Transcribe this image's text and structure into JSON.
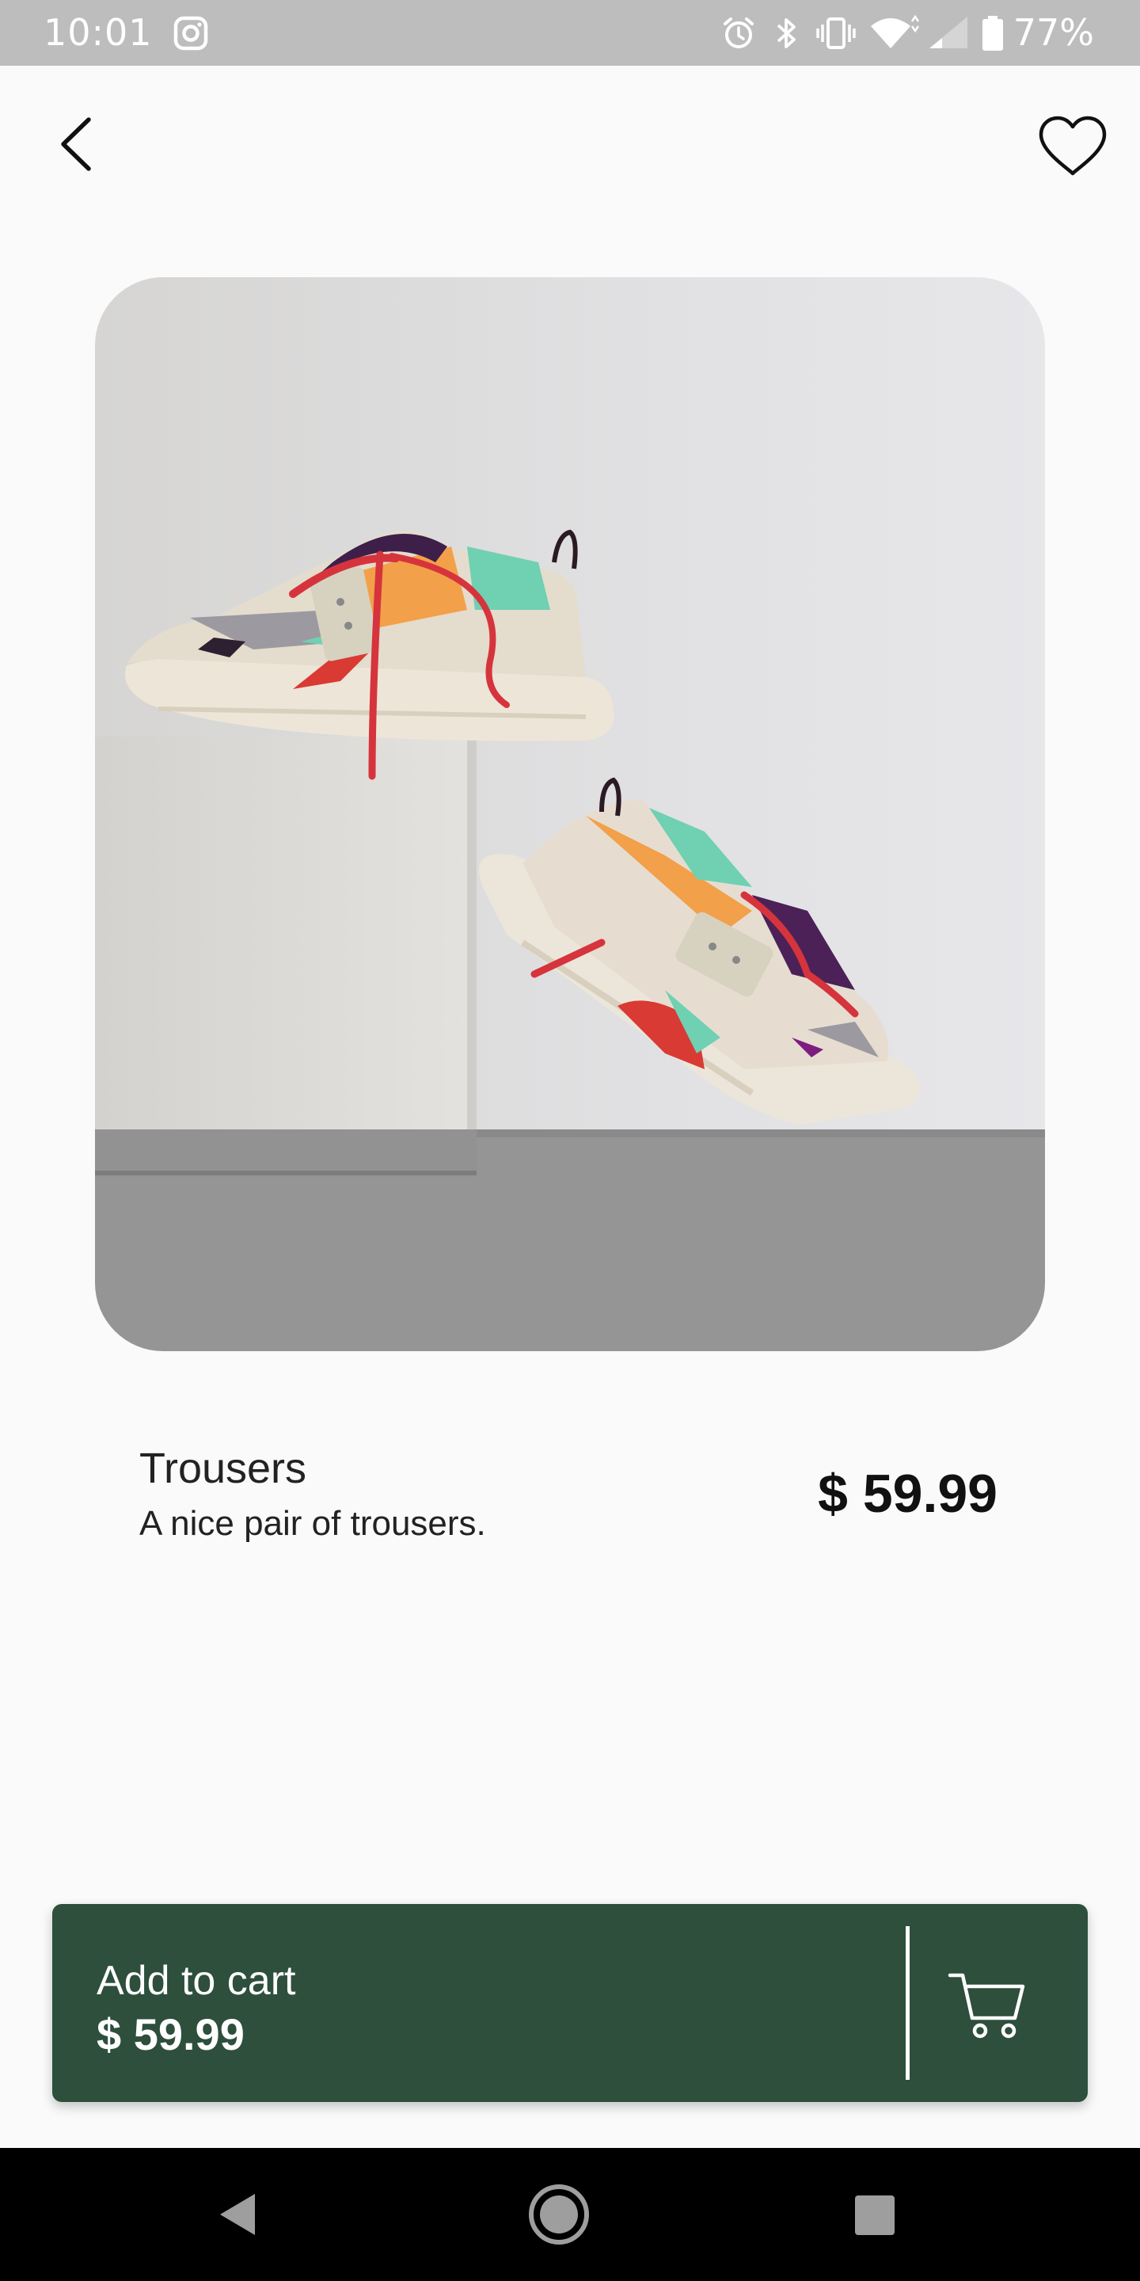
{
  "status_bar": {
    "time": "10:01",
    "battery_percent": "77%",
    "icons": [
      "instagram-icon",
      "alarm-icon",
      "bluetooth-icon",
      "vibrate-icon",
      "wifi-icon",
      "signal-icon",
      "battery-icon"
    ],
    "background_color": "#bdbdbd"
  },
  "top_bar": {
    "back_icon": "chevron-left-icon",
    "favorite_icon": "heart-outline-icon"
  },
  "product": {
    "name": "Trousers",
    "description": "A nice pair of trousers.",
    "price": "$ 59.99",
    "image": "sneakers-photo"
  },
  "cart_button": {
    "label": "Add to cart",
    "price": "$ 59.99",
    "icon": "shopping-cart-icon",
    "color": "#2d4f3c"
  },
  "nav_bar": {
    "buttons": [
      "back-triangle-icon",
      "home-circle-icon",
      "recents-square-icon"
    ]
  }
}
